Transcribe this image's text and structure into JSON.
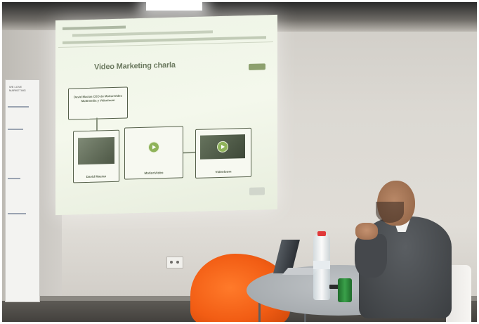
{
  "slide": {
    "title": "Video Marketing charla",
    "main_box_text": "David Macias CEO de MotionVideo Multimedia y Videoloom",
    "nodes": [
      "David Macias",
      "MotionVideo",
      "Videoloom"
    ]
  },
  "banner": {
    "text": "WE LOVE MARKETING"
  },
  "colors": {
    "slide_text": "#6c7a60",
    "beanbag": "#f25d14",
    "shirt": "#3b3e41"
  }
}
